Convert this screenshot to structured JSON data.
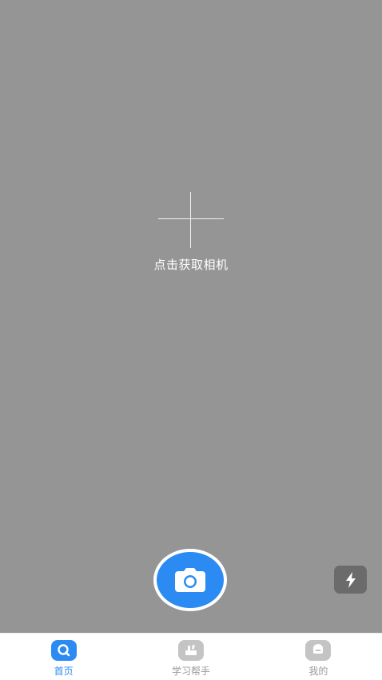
{
  "camera": {
    "hint": "点击获取相机",
    "background_color": "#959595"
  },
  "controls": {
    "shutter_icon": "camera-icon",
    "flash_icon": "flash-icon",
    "accent_color": "#2b8bf2"
  },
  "tabbar": {
    "tabs": [
      {
        "label": "首页",
        "icon": "search-icon",
        "active": true
      },
      {
        "label": "学习帮手",
        "icon": "study-helper-icon",
        "active": false
      },
      {
        "label": "我的",
        "icon": "profile-icon",
        "active": false
      }
    ]
  }
}
